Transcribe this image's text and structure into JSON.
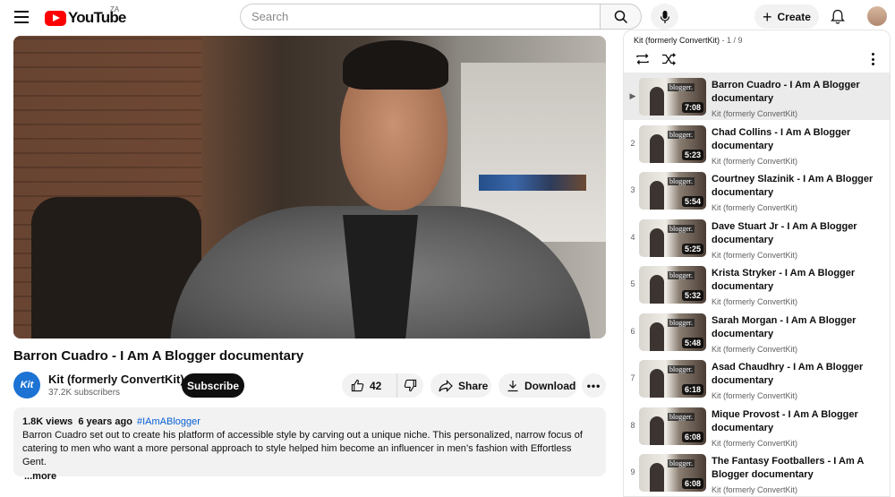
{
  "header": {
    "logo_text": "YouTube",
    "region": "ZA",
    "search_placeholder": "Search",
    "create_label": "Create"
  },
  "video": {
    "title": "Barron Cuadro - I Am A Blogger documentary",
    "channel_name": "Kit (formerly ConvertKit)",
    "channel_avatar_text": "Kit",
    "subscribers": "37.2K subscribers",
    "subscribe_label": "Subscribe",
    "likes": "42",
    "share_label": "Share",
    "download_label": "Download",
    "more_label": "•••"
  },
  "description": {
    "meta": "1.8K views  6 years ago",
    "hashtag": "#IAmABlogger",
    "text": "Barron Cuadro set out to create his platform of accessible style by carving out a unique niche. This personalized, narrow focus of catering to men who want a more personal approach to style helped him become an influencer in men’s fashion with Effortless Gent.",
    "more": "...more"
  },
  "playlist": {
    "title": "Kit (formerly ConvertKit)",
    "position": " - 1 / 9",
    "items": [
      {
        "index": "▶",
        "title": "Barron Cuadro - I Am A Blogger documentary",
        "channel": "Kit (formerly ConvertKit)",
        "duration": "7:08",
        "active": true
      },
      {
        "index": "2",
        "title": "Chad Collins - I Am A Blogger documentary",
        "channel": "Kit (formerly ConvertKit)",
        "duration": "5:23"
      },
      {
        "index": "3",
        "title": "Courtney Slazinik - I Am A Blogger documentary",
        "channel": "Kit (formerly ConvertKit)",
        "duration": "5:54"
      },
      {
        "index": "4",
        "title": "Dave Stuart Jr - I Am A Blogger documentary",
        "channel": "Kit (formerly ConvertKit)",
        "duration": "5:25"
      },
      {
        "index": "5",
        "title": "Krista Stryker - I Am A Blogger documentary",
        "channel": "Kit (formerly ConvertKit)",
        "duration": "5:32"
      },
      {
        "index": "6",
        "title": "Sarah Morgan - I Am A Blogger documentary",
        "channel": "Kit (formerly ConvertKit)",
        "duration": "5:48"
      },
      {
        "index": "7",
        "title": "Asad Chaudhry - I Am A Blogger documentary",
        "channel": "Kit (formerly ConvertKit)",
        "duration": "6:18"
      },
      {
        "index": "8",
        "title": "Mique Provost - I Am A Blogger documentary",
        "channel": "Kit (formerly ConvertKit)",
        "duration": "6:08"
      },
      {
        "index": "9",
        "title": "The Fantasy Footballers - I Am A Blogger documentary",
        "channel": "Kit (formerly ConvertKit)",
        "duration": "6:08"
      }
    ],
    "thumb_tag": "blogger."
  },
  "colors": {
    "brand_red": "#ff0000",
    "subscribe_bg": "#0f0f0f",
    "hashtag": "#065fd4",
    "active_row": "#ebebeb"
  }
}
